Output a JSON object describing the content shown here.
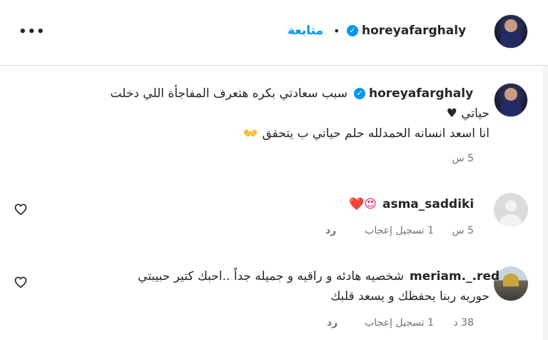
{
  "header": {
    "username": "horeyafarghaly",
    "follow_label": "متابعة",
    "separator": "•",
    "more_label": "•••"
  },
  "caption": {
    "username": "horeyafarghaly",
    "line1": "سبب سعادتي بكره هتعرف المفاجأة اللي دخلت",
    "line2": "حياتي ♥",
    "line3": "انا اسعد انسانه الحمدلله حلم حياتي ب يتحقق 👐",
    "time": "5 س"
  },
  "comments": [
    {
      "username": "asma_saddiki",
      "text": "😍❤️",
      "time": "5 س",
      "likes": "1 تسجيل إعجاب",
      "reply": "رد"
    },
    {
      "username": "meriam._.red",
      "line1": "شخصيه هادئه و راقيه و جميله جداً ..احبك كتير حبيبتي",
      "line2": "حوريه ربنا يحفظك و يسعد قلبك",
      "time": "38 د",
      "likes": "1 تسجيل إعجاب",
      "reply": "رد"
    }
  ],
  "icons": {
    "verified": "verified-badge-icon",
    "like": "heart-outline-icon",
    "more": "more-options-icon"
  },
  "colors": {
    "accent": "#0095f6",
    "text": "#262626",
    "muted": "#737373",
    "border": "#dbdbdb"
  }
}
